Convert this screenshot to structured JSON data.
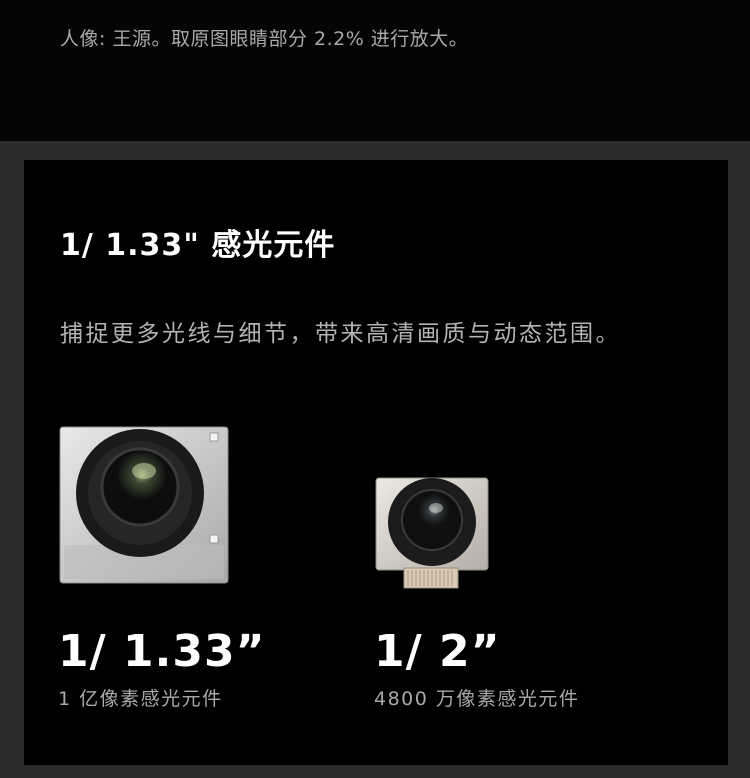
{
  "caption": "人像: 王源。取原图眼睛部分 2.2% 进行放大。",
  "section": {
    "title": "1/ 1.33\" 感光元件",
    "description": "捕捉更多光线与细节，带来高清画质与动态范围。"
  },
  "sensors": [
    {
      "size": "1/ 1.33”",
      "label": "1 亿像素感光元件"
    },
    {
      "size": "1/ 2”",
      "label": "4800 万像素感光元件"
    }
  ]
}
